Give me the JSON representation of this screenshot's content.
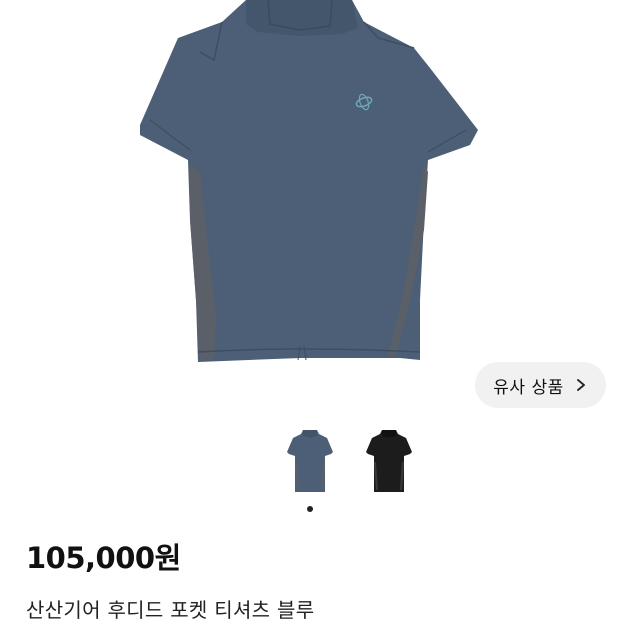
{
  "product": {
    "similar_button_label": "유사 상품",
    "price": "105,000원",
    "title": "산산기어 후디드 포켓 티셔츠 블루"
  },
  "colors": {
    "shirt_blue": "#4c5f76",
    "shirt_black": "#1c1c1c",
    "side_panel": "#5b6068",
    "button_bg": "#f1f1f1",
    "dot": "#222222"
  },
  "gallery": {
    "thumbnails": [
      "blue-hoodie-thumbnail",
      "black-hoodie-thumbnail"
    ],
    "active_index": 0
  }
}
